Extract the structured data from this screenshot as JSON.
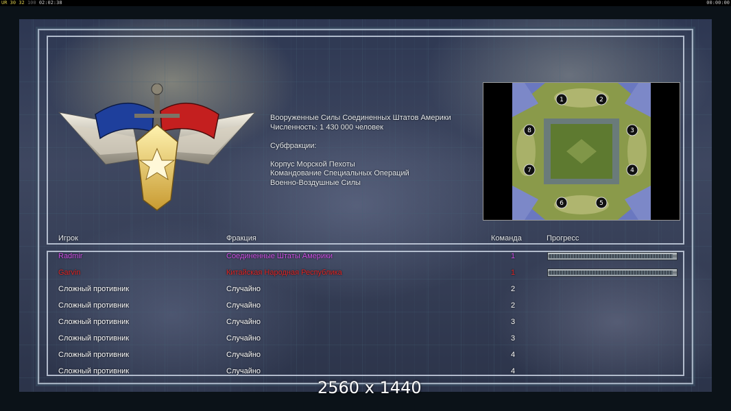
{
  "hud": {
    "left_prefix": "UR",
    "left_a": "30",
    "left_b": "32",
    "left_c": "100",
    "left_time": "02:02:38",
    "right_time": "00:00:00"
  },
  "faction_info": {
    "lines": [
      "Вооруженные Силы Соединенных Штатов Америки",
      "Численность: 1 430 000 человек",
      "",
      "Субфракции:",
      "",
      "Корпус Морской Пехоты",
      "Командование Специальных Операций",
      "Военно-Воздушные Силы"
    ]
  },
  "map": {
    "slots": [
      "1",
      "2",
      "3",
      "4",
      "5",
      "6",
      "7",
      "8"
    ]
  },
  "table": {
    "headers": {
      "player": "Игрок",
      "faction": "Фракция",
      "team": "Команда",
      "progress": "Прогресс"
    },
    "rows": [
      {
        "player": "Radmir",
        "faction": "Соединенные Штаты Америки",
        "team": "1",
        "color": "#d050e6",
        "progress": 0.98
      },
      {
        "player": "Garvin",
        "faction": "Китайская Народная Республика",
        "team": "1",
        "color": "#e02525",
        "progress": 0.98
      },
      {
        "player": "Сложный противник",
        "faction": "Случайно",
        "team": "2"
      },
      {
        "player": "Сложный противник",
        "faction": "Случайно",
        "team": "2"
      },
      {
        "player": "Сложный противник",
        "faction": "Случайно",
        "team": "3"
      },
      {
        "player": "Сложный противник",
        "faction": "Случайно",
        "team": "3"
      },
      {
        "player": "Сложный противник",
        "faction": "Случайно",
        "team": "4"
      },
      {
        "player": "Сложный противник",
        "faction": "Случайно",
        "team": "4"
      }
    ]
  },
  "watermark": "2560 x 1440"
}
